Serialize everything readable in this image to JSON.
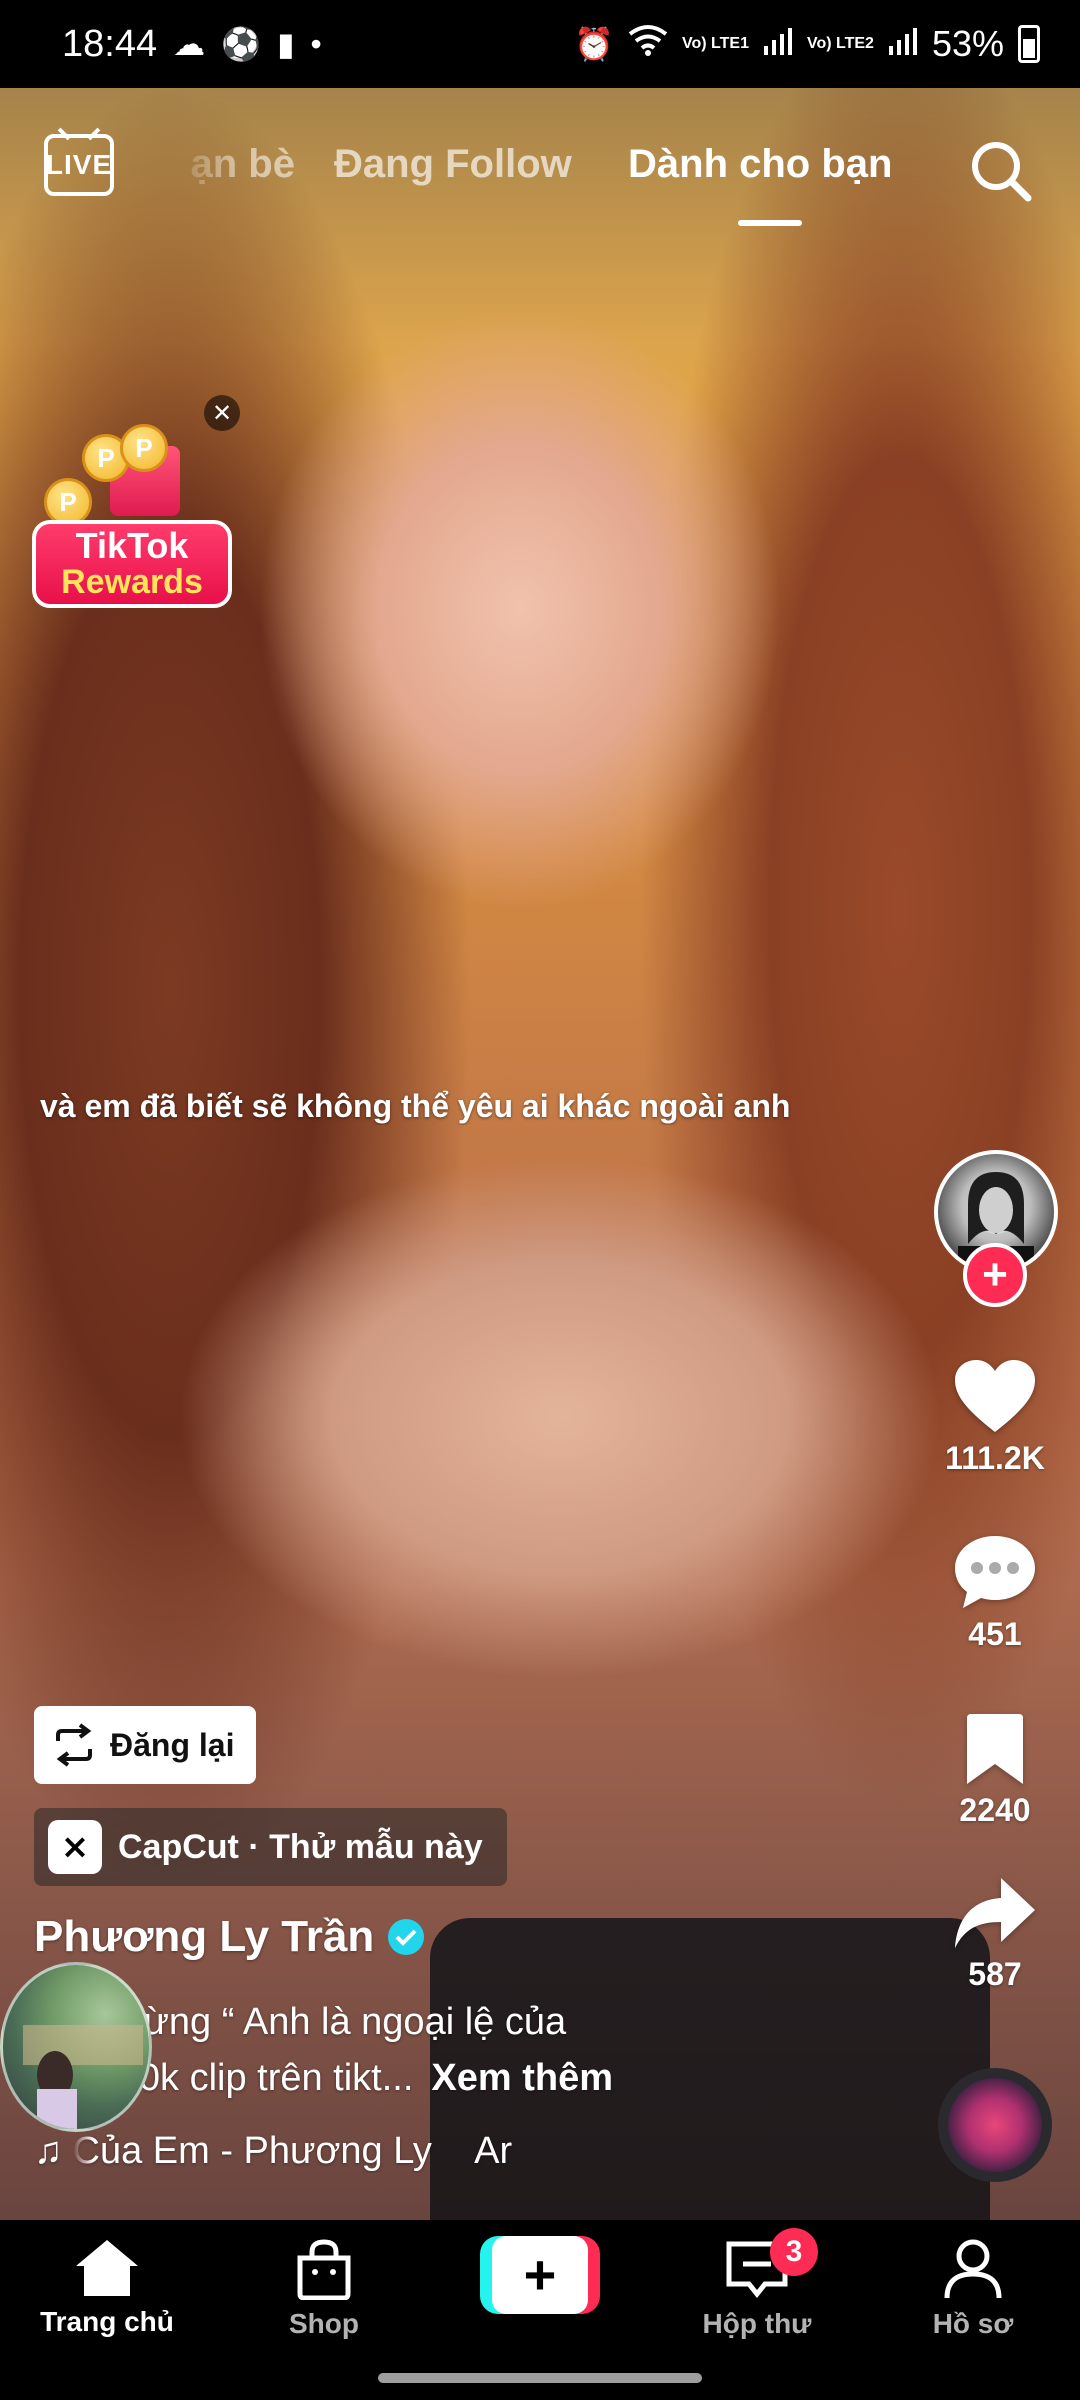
{
  "status_bar": {
    "time": "18:44",
    "battery": "53%",
    "network1": "Vo) LTE1",
    "network2": "Vo) LTE2"
  },
  "top_nav": {
    "live_label": "LIVE",
    "tabs": [
      {
        "label": "Bạn bè",
        "visible_text": "ạn bè"
      },
      {
        "label": "Đang Follow"
      },
      {
        "label": "Dành cho bạn",
        "active": true
      }
    ]
  },
  "rewards": {
    "line1": "TikTok",
    "line2": "Rewards",
    "coin_letter": "P"
  },
  "video_caption": "và em đã biết sẽ không thể yêu ai khác ngoài anh",
  "actions": {
    "likes": "111.2K",
    "comments": "451",
    "saves": "2240",
    "shares": "587"
  },
  "post": {
    "repost_label": "Đăng lại",
    "template_label": "CapCut · Thử mẫu này",
    "author": "Phương Ly Trần",
    "desc_line1": "húc mừng “ Anh là ngoại lệ của",
    "desc_line2": "hơn 50k clip trên tikt...",
    "see_more": "Xem thêm",
    "music": "Của Em - Phương Ly",
    "music_tail": "Ar"
  },
  "bottom_nav": {
    "home": "Trang chủ",
    "shop": "Shop",
    "inbox": "Hộp thư",
    "inbox_badge": "3",
    "profile": "Hồ sơ"
  },
  "colors": {
    "accent_red": "#fe2c55",
    "accent_cyan": "#25f4ee",
    "verified": "#20d5ec"
  }
}
